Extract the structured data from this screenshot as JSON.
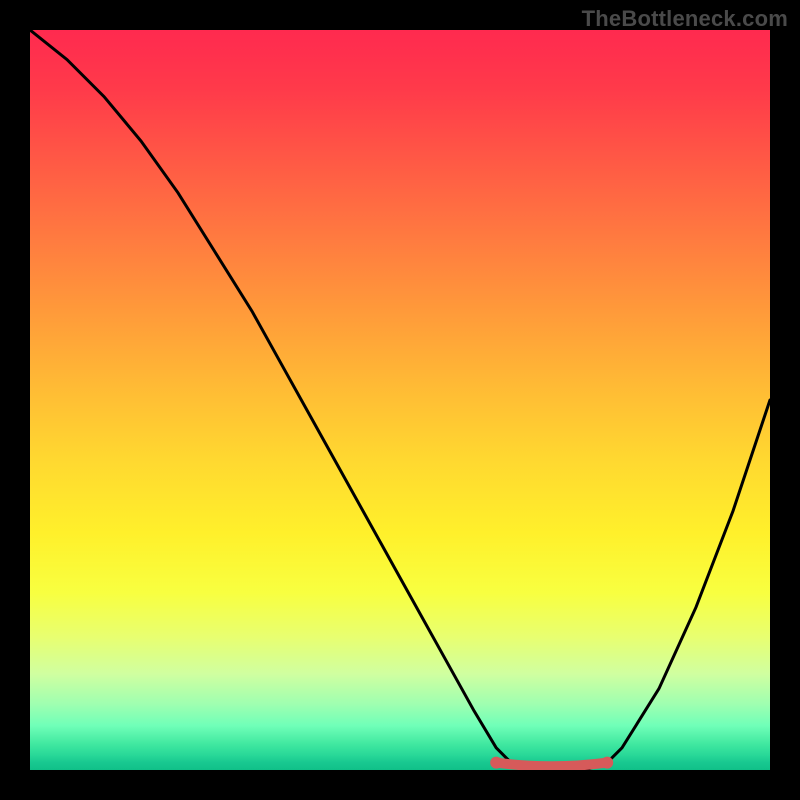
{
  "watermark": "TheBottleneck.com",
  "chart_data": {
    "type": "line",
    "title": "",
    "xlabel": "",
    "ylabel": "",
    "xlim": [
      0,
      100
    ],
    "ylim": [
      0,
      100
    ],
    "grid": false,
    "series": [
      {
        "name": "curve",
        "color": "#000000",
        "x": [
          0,
          5,
          10,
          15,
          20,
          25,
          30,
          35,
          40,
          45,
          50,
          55,
          60,
          63,
          65,
          70,
          75,
          78,
          80,
          85,
          90,
          95,
          100
        ],
        "values": [
          100,
          96,
          91,
          85,
          78,
          70,
          62,
          53,
          44,
          35,
          26,
          17,
          8,
          3,
          1,
          0,
          0,
          1,
          3,
          11,
          22,
          35,
          50
        ]
      }
    ],
    "markers": [
      {
        "name": "flat-start",
        "x": 63,
        "value": 1,
        "color": "#d65a5a",
        "size": 6
      },
      {
        "name": "flat-segment",
        "x": 70,
        "value": 0,
        "color": "#d65a5a",
        "size": 6
      },
      {
        "name": "flat-end",
        "x": 78,
        "value": 1,
        "color": "#d65a5a",
        "size": 6
      }
    ]
  }
}
